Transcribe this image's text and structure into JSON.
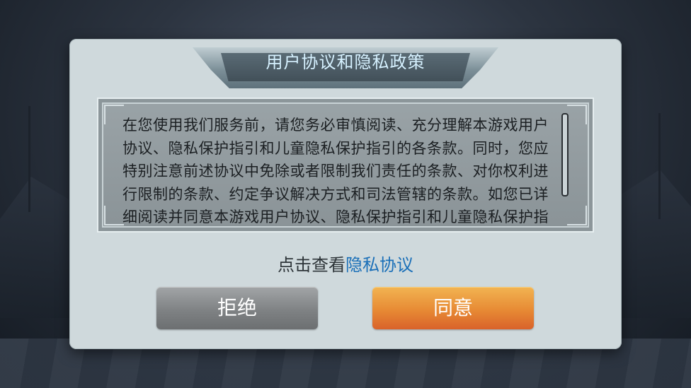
{
  "dialog": {
    "title": "用户协议和隐私政策",
    "content": "在您使用我们服务前，请您务必审慎阅读、充分理解本游戏用户协议、隐私保护指引和儿童隐私保护指引的各条款。同时，您应特别注意前述协议中免除或者限制我们责任的条款、对你权利进行限制的条款、约定争议解决方式和司法管辖的条款。如您已详细阅读并同意本游戏用户协议、隐私保护指引和儿童隐私保护指引，请点击“同意”开始",
    "privacy_prefix": "点击查看",
    "privacy_link": "隐私协议",
    "reject_label": "拒绝",
    "agree_label": "同意"
  },
  "colors": {
    "title_text": "#d6f1ff",
    "link": "#1a6fb8",
    "agree_button": "#e78a34",
    "reject_button": "#7f8284"
  }
}
